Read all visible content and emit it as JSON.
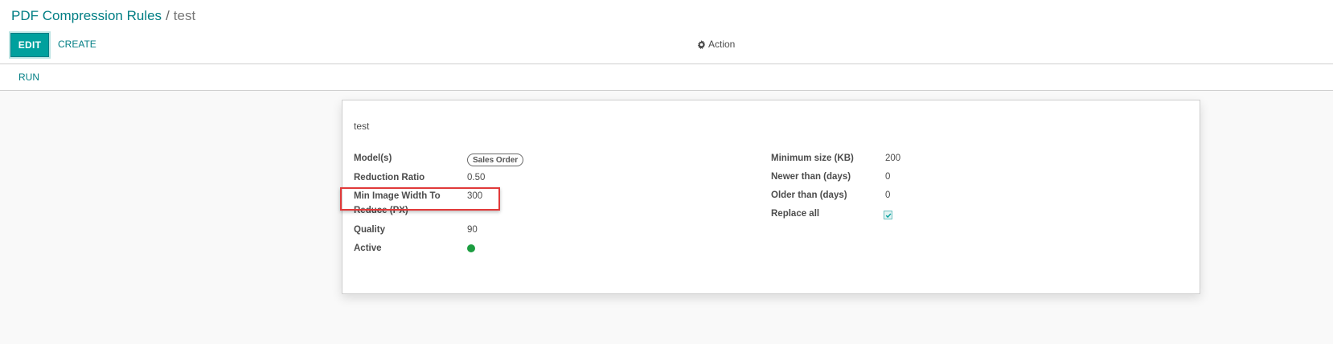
{
  "breadcrumb": {
    "parent": "PDF Compression Rules",
    "separator": "/",
    "current": "test"
  },
  "toolbar": {
    "edit_label": "EDIT",
    "create_label": "CREATE",
    "action_label": "Action",
    "run_label": "RUN"
  },
  "record": {
    "name": "test",
    "left_fields": {
      "models": {
        "label": "Model(s)",
        "tag": "Sales Order"
      },
      "reduction_ratio": {
        "label": "Reduction Ratio",
        "value": "0.50"
      },
      "min_image_width": {
        "label": "Min Image Width To Reduce (PX)",
        "value": "300"
      },
      "quality": {
        "label": "Quality",
        "value": "90"
      },
      "active": {
        "label": "Active",
        "status_color": "#1c9d40"
      }
    },
    "right_fields": {
      "minimum_size": {
        "label": "Minimum size (KB)",
        "value": "200"
      },
      "newer_than": {
        "label": "Newer than (days)",
        "value": "0"
      },
      "older_than": {
        "label": "Older than (days)",
        "value": "0"
      },
      "replace_all": {
        "label": "Replace all",
        "checked": true
      }
    }
  },
  "colors": {
    "accent": "#00a09d",
    "link": "#017e84",
    "highlight": "#e13a3a"
  }
}
